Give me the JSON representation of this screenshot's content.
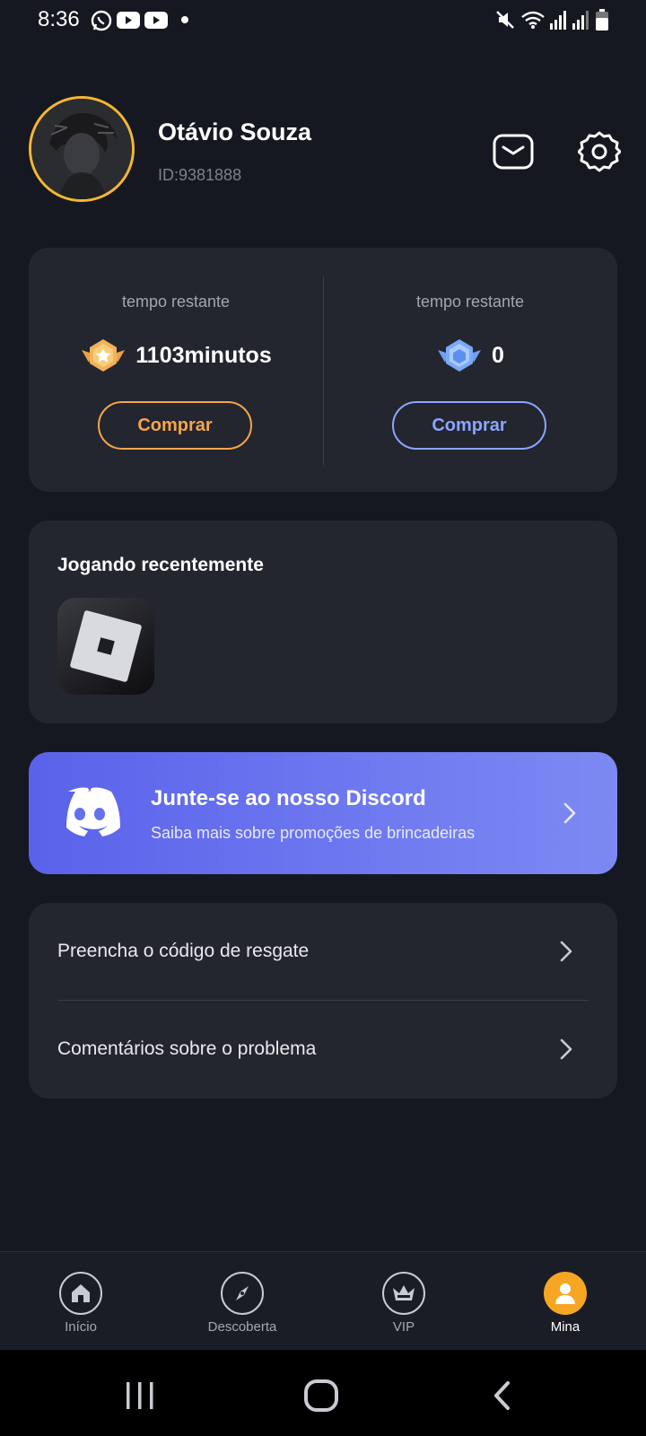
{
  "status_bar": {
    "time": "8:36",
    "icons": [
      "whatsapp-icon",
      "youtube-icon",
      "youtube-icon",
      "dot-icon",
      "mute-icon",
      "wifi-icon",
      "signal-icon",
      "signal-icon",
      "battery-icon"
    ]
  },
  "profile": {
    "name": "Otávio Souza",
    "id": "ID:9381888",
    "avatar_border_color": "#f5b731"
  },
  "header_icons": [
    "mail-icon",
    "gear-icon"
  ],
  "balances": [
    {
      "label": "tempo restante",
      "value": "1103minutos",
      "icon": "gold-badge-icon",
      "button": "Comprar",
      "accent": "#f5a64a"
    },
    {
      "label": "tempo restante",
      "value": "0",
      "icon": "blue-badge-icon",
      "button": "Comprar",
      "accent": "#8aa6ff"
    }
  ],
  "recent": {
    "title": "Jogando recentemente",
    "games": [
      "roblox-icon"
    ]
  },
  "discord": {
    "title": "Junte-se ao nosso Discord",
    "subtitle": "Saiba mais sobre promoções de brincadeiras",
    "icon": "discord-icon"
  },
  "menu": [
    {
      "label": "Preencha o código de resgate"
    },
    {
      "label": "Comentários sobre o problema"
    }
  ],
  "bottom_nav": [
    {
      "label": "Início",
      "icon": "home-icon",
      "active": false
    },
    {
      "label": "Descoberta",
      "icon": "compass-icon",
      "active": false
    },
    {
      "label": "VIP",
      "icon": "crown-icon",
      "active": false
    },
    {
      "label": "Mina",
      "icon": "user-icon",
      "active": true
    }
  ],
  "colors": {
    "background": "#161821",
    "card": "#23252f",
    "active_nav": "#f6a623",
    "discord_gradient_start": "#5a62ea",
    "discord_gradient_end": "#7d89f2"
  }
}
